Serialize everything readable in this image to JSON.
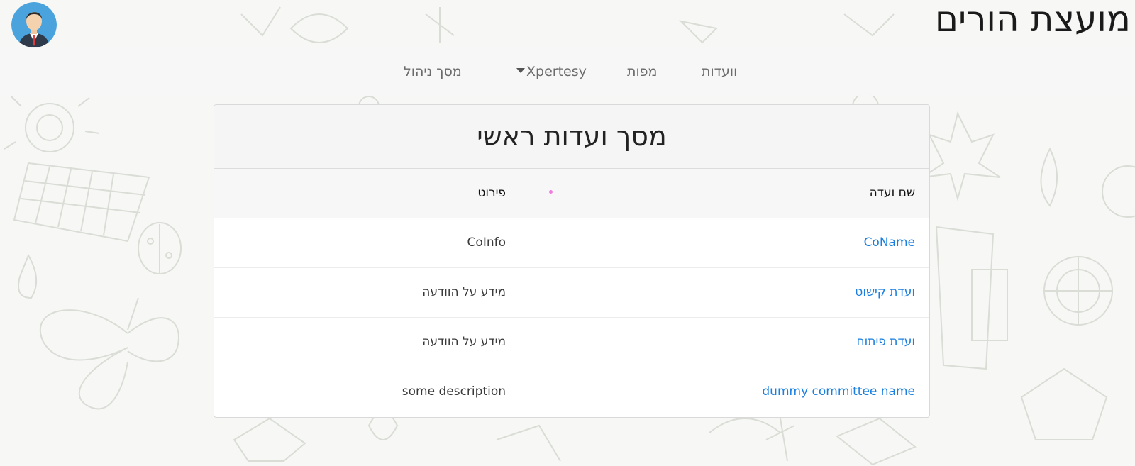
{
  "site": {
    "title": "מועצת הורים"
  },
  "nav": {
    "committees": "וועדות",
    "maps": "מפות",
    "xpertesy": "Xpertesy",
    "admin": "מסך ניהול"
  },
  "card": {
    "title": "מסך ועדות ראשי",
    "columns": {
      "name": "שם ועדה",
      "info": "פירוט"
    },
    "rows": [
      {
        "name": "CoName",
        "info": "CoInfo"
      },
      {
        "name": "ועדת קישוט",
        "info": "מידע על הוודעה"
      },
      {
        "name": "ועדת פיתוח",
        "info": "מידע על הוודעה"
      },
      {
        "name": "dummy committee name",
        "info": "some description"
      }
    ]
  },
  "colors": {
    "link": "#1a7fe0",
    "navbar_bg": "#f7f7f8",
    "card_header_bg": "#f5f5f5",
    "accent_dot": "#f27ae0"
  },
  "icons": {
    "avatar": "user-avatar-icon",
    "dropdown": "caret-down-icon"
  }
}
